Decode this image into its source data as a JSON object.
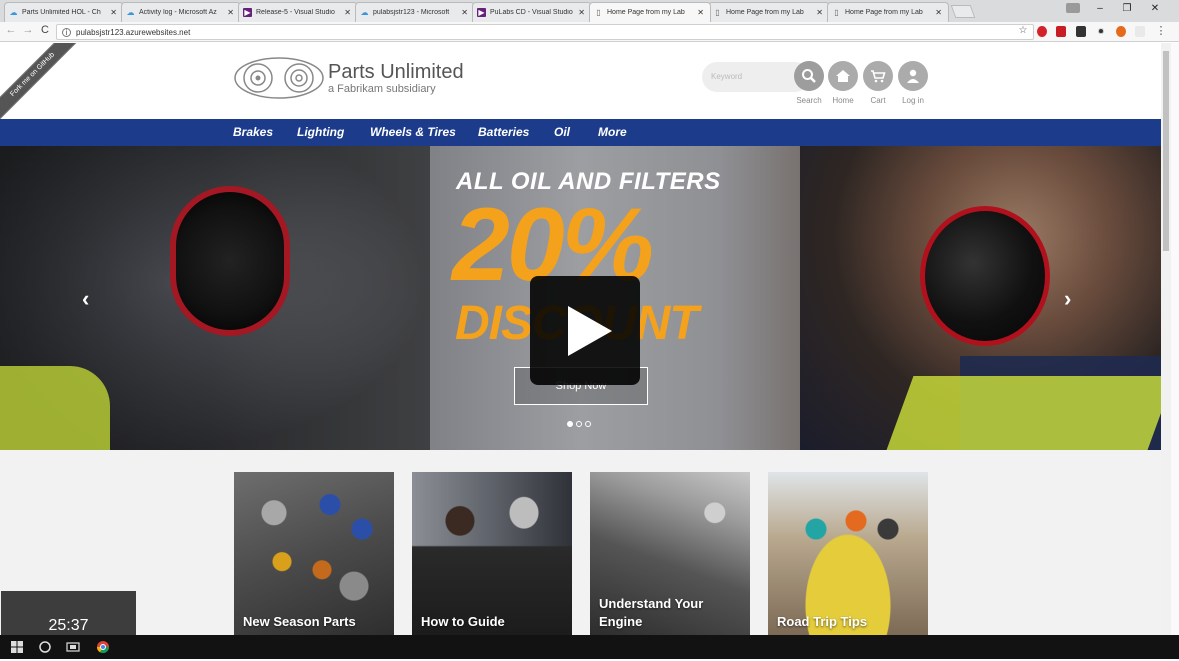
{
  "browser": {
    "tabs": [
      {
        "title": "Parts Unlimited HOL - Ch",
        "favicon": "cloud-icon",
        "active": false
      },
      {
        "title": "Activity log - Microsoft Az",
        "favicon": "cloud-icon",
        "active": false
      },
      {
        "title": "Release-5 - Visual Studio",
        "favicon": "vs-icon",
        "active": false
      },
      {
        "title": "pulabsjstr123 - Microsoft",
        "favicon": "cloud-icon",
        "active": false
      },
      {
        "title": "PuLabs CD - Visual Studio",
        "favicon": "vs-icon",
        "active": false
      },
      {
        "title": "Home Page from my Lab",
        "favicon": "page-icon",
        "active": true
      },
      {
        "title": "Home Page from my Lab",
        "favicon": "page-icon",
        "active": false
      },
      {
        "title": "Home Page from my Lab",
        "favicon": "page-icon",
        "active": false
      }
    ],
    "url": "pulabsjstr123.azurewebsites.net"
  },
  "site": {
    "ribbon": "Fork me on GitHub",
    "logo_title": "Parts Unlimited",
    "logo_subtitle": "a Fabrikam subsidiary",
    "search_placeholder": "Keyword",
    "header_actions": [
      {
        "label": "Search",
        "icon": "search-icon"
      },
      {
        "label": "Home",
        "icon": "home-icon"
      },
      {
        "label": "Cart",
        "icon": "cart-icon"
      },
      {
        "label": "Log in",
        "icon": "user-icon"
      }
    ],
    "nav": [
      "Brakes",
      "Lighting",
      "Wheels & Tires",
      "Batteries",
      "Oil",
      "More"
    ],
    "hero": {
      "line1": "ALL OIL AND FILTERS",
      "line2": "20%",
      "line3": "DISCOUNT",
      "cta": "Shop Now",
      "slide_index": 1,
      "slide_count": 3,
      "accent_color": "#f4a11c"
    },
    "cards": [
      {
        "caption": "New Season Parts"
      },
      {
        "caption": "How to Guide"
      },
      {
        "caption": "Understand Your Engine"
      },
      {
        "caption": "Road Trip Tips"
      }
    ],
    "nav_color": "#1c3c8b"
  },
  "video": {
    "timestamp": "25:37"
  }
}
